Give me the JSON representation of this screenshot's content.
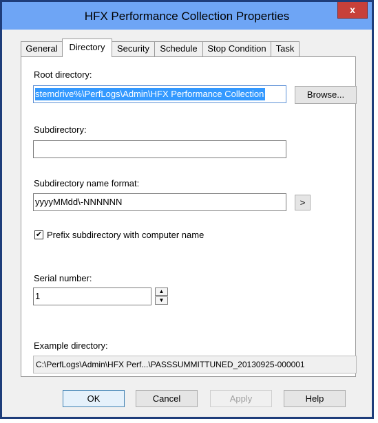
{
  "window": {
    "title": "HFX Performance Collection Properties",
    "close_label": "x"
  },
  "tabs": [
    {
      "label": "General"
    },
    {
      "label": "Directory"
    },
    {
      "label": "Security"
    },
    {
      "label": "Schedule"
    },
    {
      "label": "Stop Condition"
    },
    {
      "label": "Task"
    }
  ],
  "active_tab": "Directory",
  "form": {
    "root_directory_label": "Root directory:",
    "root_directory_value": "stemdrive%\\PerfLogs\\Admin\\HFX Performance Collection",
    "browse_label": "Browse...",
    "subdirectory_label": "Subdirectory:",
    "subdirectory_value": "",
    "name_format_label": "Subdirectory name format:",
    "name_format_value": "yyyyMMdd\\-NNNNNN",
    "format_button_label": ">",
    "prefix_checkbox_label": "Prefix subdirectory with computer name",
    "prefix_checked": true,
    "check_glyph": "✔",
    "serial_label": "Serial number:",
    "serial_value": "1",
    "spin_up_glyph": "▲",
    "spin_down_glyph": "▼",
    "example_label": "Example directory:",
    "example_value": "C:\\PerfLogs\\Admin\\HFX Perf...\\PASSSUMMITTUNED_20130925-000001"
  },
  "buttons": {
    "ok": "OK",
    "cancel": "Cancel",
    "apply": "Apply",
    "help": "Help"
  },
  "colors": {
    "titlebar": "#6ea5f5",
    "window_border": "#1e3d7a",
    "close_button": "#c7403a",
    "selection": "#3399ff"
  }
}
